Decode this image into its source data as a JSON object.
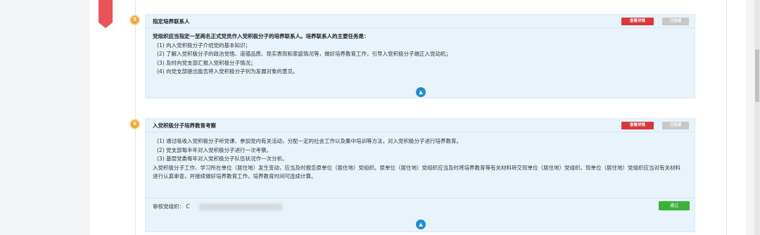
{
  "step5": {
    "number": "5",
    "title": "指定培养联系人",
    "detail_label": "查看详情",
    "status_label": "已完成",
    "intro": "党组织应当指定一至两名正式党员作入党积极分子的培养联系人。培养联系人的主要任务是：",
    "items": [
      "(1) 向入党积极分子介绍党的基本知识；",
      "(2) 了解入党积极分子的政治觉悟、道德品质、现实表现和家庭情况等，做好培养教育工作，引导入党积极分子端正入党动机；",
      "(3) 及时向党支部汇报入党积极分子情况；",
      "(4) 向党支部提出能否将入党积极分子列为发展对象的意见。"
    ]
  },
  "step6": {
    "number": "6",
    "title": "入党积极分子培养教育考察",
    "detail_label": "查看详情",
    "status_label": "已完成",
    "items": [
      "(1) 通过吸收入党积极分子听党课、参加党内有关活动，分配一定的社会工作以及集中培训等方法，对入党积极分子进行培养教育。",
      "(2) 党支部每半年对入党积极分子进行一次考察。",
      "(3) 基层党委每年对入党积极分子队伍状况作一次分析。"
    ],
    "paragraph": "入党积极分子工作、学习所在单位（居住地）发生变动，应当及时报告原单位（居住地）党组织。原单位（居住地）党组织应当及时将培养教育等有关材料转交现单位（居住地）党组织。现单位（居住地）党组织应当对有关材料进行认真审查，并接续做好培养教育工作。培养教育时间可连续计算。",
    "review_label": "审核党组织：",
    "review_value_partial": "C",
    "pass_label": "通过"
  },
  "colors": {
    "bookmark": "#e9545a",
    "badge": "#f1a431",
    "detail_button": "#d9383b",
    "pass_button": "#3ab23a",
    "toggle": "#1d8fd1"
  },
  "icons": {
    "collapse": "chevron-up-icon"
  }
}
